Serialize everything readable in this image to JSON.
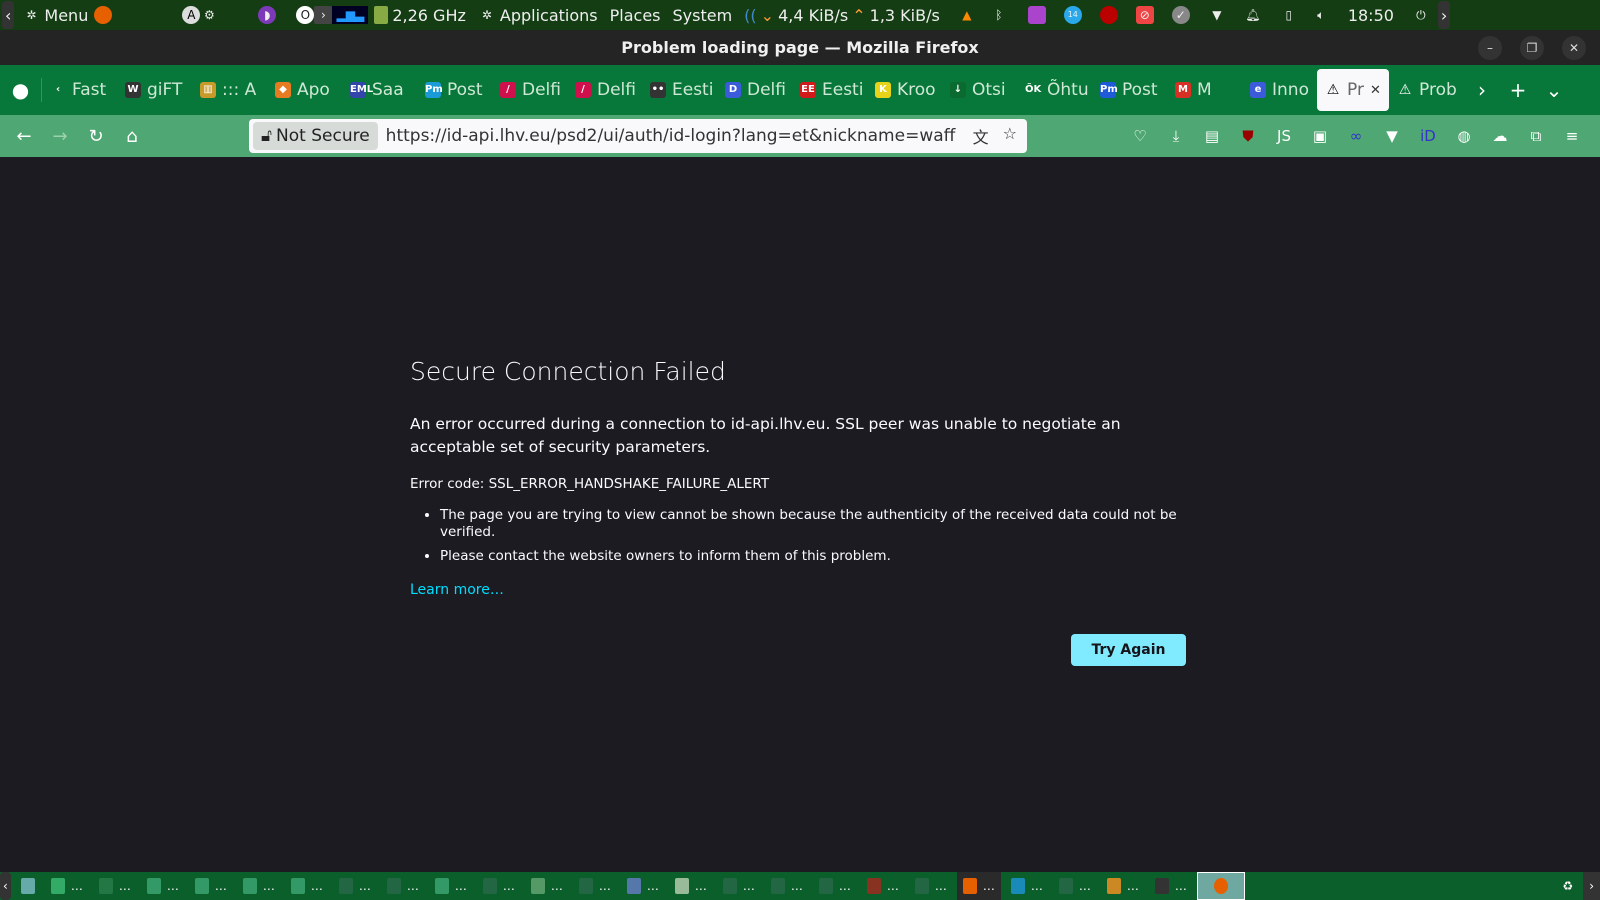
{
  "panel": {
    "menu": "Menu",
    "cpu": "2,26 GHz",
    "applications": "Applications",
    "places": "Places",
    "system": "System",
    "net_down": "4,4 KiB/s",
    "net_up": "1,3 KiB/s",
    "badge": "14",
    "clock": "18:50"
  },
  "window": {
    "title": "Problem loading page — Mozilla Firefox"
  },
  "tabs": [
    {
      "label": "Fast",
      "icon": "‹",
      "color": "transparent"
    },
    {
      "label": "giFT",
      "icon": "W",
      "color": "#333"
    },
    {
      "label": "::: A",
      "icon": "▥",
      "color": "#c89a2a"
    },
    {
      "label": "Apo",
      "icon": "◆",
      "color": "#e77b22"
    },
    {
      "label": "Saa",
      "icon": "EML",
      "color": "#3344aa"
    },
    {
      "label": "Post",
      "icon": "Pm",
      "color": "#1a9bd7"
    },
    {
      "label": "Delfi",
      "icon": "/",
      "color": "#d0104c"
    },
    {
      "label": "Delfi",
      "icon": "/",
      "color": "#d0104c"
    },
    {
      "label": "Eesti",
      "icon": "••",
      "color": "#333"
    },
    {
      "label": "Delfi",
      "icon": "D",
      "color": "#3b5bdb"
    },
    {
      "label": "Eesti",
      "icon": "EE",
      "color": "#d21a1a"
    },
    {
      "label": "Kroo",
      "icon": "K",
      "color": "#e8d21a"
    },
    {
      "label": "Otsi",
      "icon": "↓",
      "color": "#0a6a30"
    },
    {
      "label": "Õhtu",
      "icon": "ÕK",
      "color": "transparent"
    },
    {
      "label": "Post",
      "icon": "Pm",
      "color": "#1f5bd8"
    },
    {
      "label": "M",
      "icon": "M",
      "color": "#d93025"
    },
    {
      "label": "Inno",
      "icon": "e",
      "color": "#3b5bdb"
    },
    {
      "label": "Pr",
      "icon": "⚠",
      "color": "transparent",
      "active": true
    },
    {
      "label": "Prob",
      "icon": "⚠",
      "color": "transparent"
    }
  ],
  "nav": {
    "security_label": "Not Secure",
    "url": "https://id-api.lhv.eu/psd2/ui/auth/id-login?lang=et&nickname=waff"
  },
  "error": {
    "title": "Secure Connection Failed",
    "description": "An error occurred during a connection to id-api.lhv.eu. SSL peer was unable to negotiate an acceptable set of security parameters.",
    "code": "Error code: SSL_ERROR_HANDSHAKE_FAILURE_ALERT",
    "bullets": [
      "The page you are trying to view cannot be shown because the authenticity of the received data could not be verified.",
      "Please contact the website owners to inform them of this problem."
    ],
    "learn_more": "Learn more…",
    "try_again": "Try Again"
  },
  "taskbar": {
    "ellipsis": "…"
  },
  "colors": {
    "accent": "#80ebff",
    "link": "#00ddff",
    "page_bg": "#1c1b22",
    "tabbar": "#08773a",
    "navbar": "#4fa873"
  }
}
